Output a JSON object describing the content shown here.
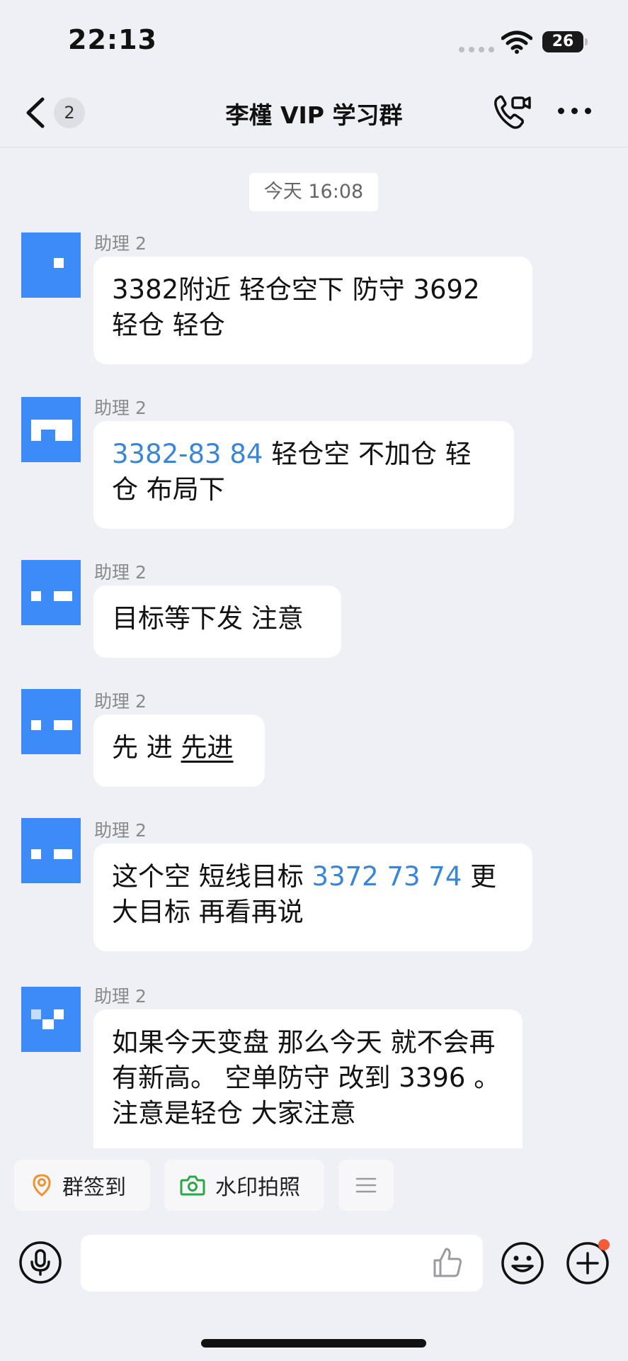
{
  "status_bar": {
    "time": "22:13",
    "battery": "26"
  },
  "navbar": {
    "unread_count": "2",
    "title": "李槿 VIP 学习群"
  },
  "chat": {
    "timestamp": "今天 16:08",
    "messages": [
      {
        "sender": "助理 2",
        "segments": [
          {
            "text": "3382附近 轻仓空下  防守 3692 轻仓 轻仓",
            "style": "normal"
          }
        ]
      },
      {
        "sender": "助理 2",
        "segments": [
          {
            "text": "3382-83 84",
            "style": "link"
          },
          {
            "text": " 轻仓空  不加仓 轻仓 布局下",
            "style": "normal"
          }
        ]
      },
      {
        "sender": "助理 2",
        "segments": [
          {
            "text": "目标等下发  注意",
            "style": "normal"
          }
        ]
      },
      {
        "sender": "助理 2",
        "segments": [
          {
            "text": "先 进  ",
            "style": "normal"
          },
          {
            "text": "先进",
            "style": "underline"
          }
        ]
      },
      {
        "sender": "助理 2",
        "segments": [
          {
            "text": "这个空 短线目标  ",
            "style": "normal"
          },
          {
            "text": "3372 73 74",
            "style": "link"
          },
          {
            "text": "  更大目标 再看再说",
            "style": "normal"
          }
        ]
      },
      {
        "sender": "助理 2",
        "segments": [
          {
            "text": "如果今天变盘  那么今天 就不会再有新高。 空单防守  改到 3396  。注意是轻仓   大家注意",
            "style": "normal"
          }
        ]
      }
    ]
  },
  "quick_actions": {
    "checkin": "群签到",
    "watermark_photo": "水印拍照"
  },
  "input": {
    "placeholder": ""
  },
  "colors": {
    "accent_link": "#3a86d6",
    "avatar": "#3c8bf6",
    "badge_red": "#f35b39"
  },
  "icons": [
    "back-icon",
    "video-call-icon",
    "more-icon",
    "location-pin-icon",
    "camera-icon",
    "menu-icon",
    "microphone-icon",
    "thumbs-up-icon",
    "emoji-icon",
    "plus-icon"
  ]
}
